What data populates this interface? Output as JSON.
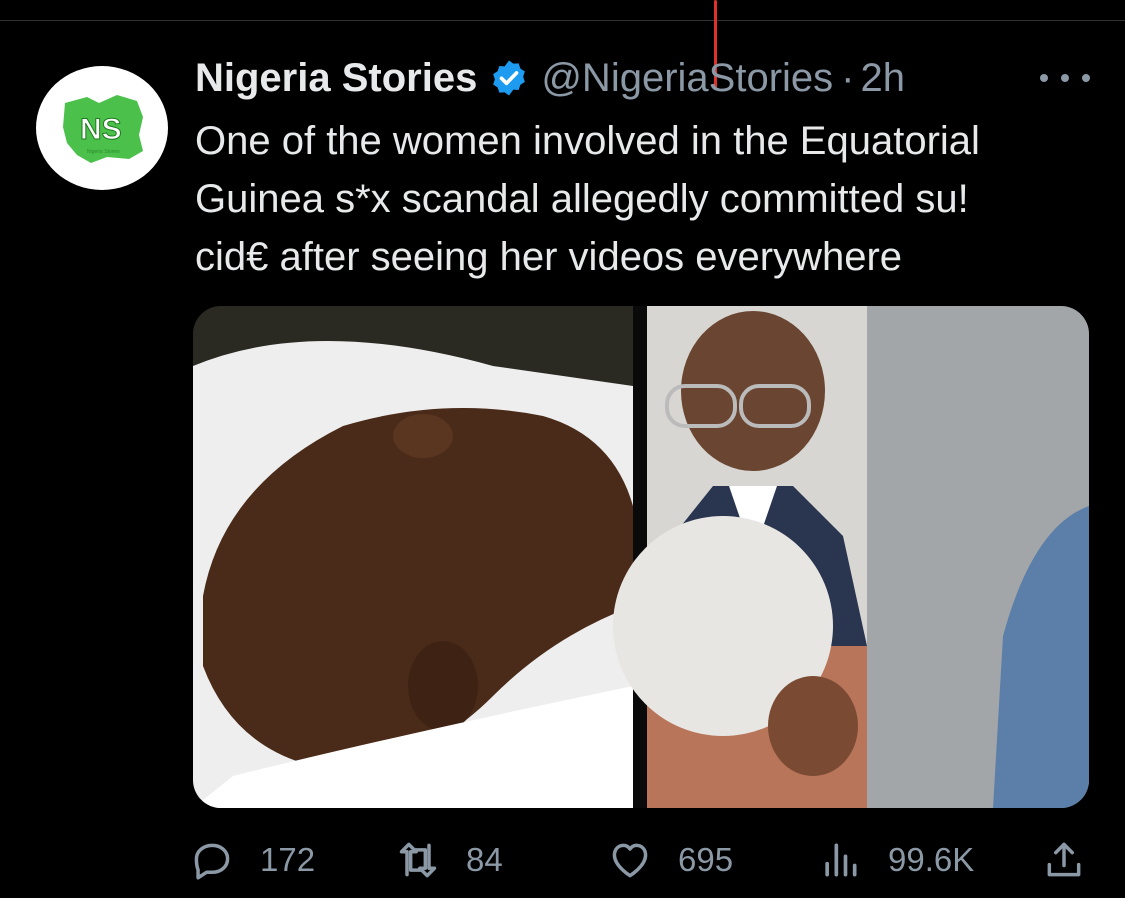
{
  "tweet": {
    "author_name": "Nigeria Stories",
    "handle": "@NigeriaStories",
    "separator": "·",
    "time": "2h",
    "avatar_text": "NS",
    "avatar_subtext": "Nigeria Stories",
    "text_lines": [
      "One of the women involved in the Equatorial",
      "Guinea s*x scandal allegedly committed su!",
      "cid€ after seeing her videos everywhere"
    ]
  },
  "actions": {
    "replies": "172",
    "retweets": "84",
    "likes": "695",
    "views": "99.6K"
  },
  "icons": {
    "verified": "verified-badge-icon",
    "more": "more-options-icon",
    "reply": "reply-icon",
    "retweet": "retweet-icon",
    "like": "heart-icon",
    "views": "views-chart-icon",
    "share": "share-icon"
  },
  "colors": {
    "background": "#000000",
    "text_primary": "#e7e9ea",
    "text_secondary": "#8b98a5",
    "verified_blue": "#1d9bf0",
    "brand_green": "#3fbf3f"
  }
}
